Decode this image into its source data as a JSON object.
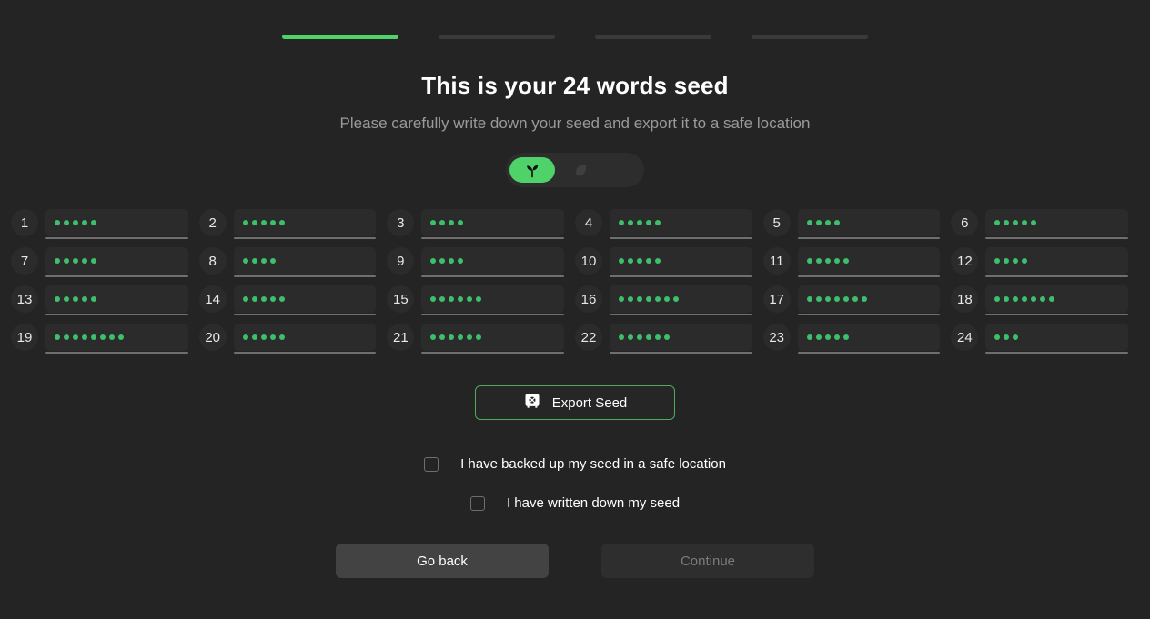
{
  "window": {
    "background": "#242424",
    "accent": "#4fd26a"
  },
  "progress": {
    "steps": [
      {
        "name": "step-1",
        "state": "active"
      },
      {
        "name": "step-2",
        "state": "inactive"
      },
      {
        "name": "step-3",
        "state": "inactive"
      },
      {
        "name": "step-4",
        "state": "inactive"
      }
    ],
    "current": 1,
    "total": 4
  },
  "header": {
    "title": "This is your 24 words seed",
    "subtitle": "Please carefully write down your seed and export it to a safe location"
  },
  "toggle": {
    "options": [
      {
        "icon": "sprout-icon",
        "selected": true
      },
      {
        "icon": "leaf-icon",
        "selected": false
      }
    ]
  },
  "seed": {
    "word_count": 24,
    "masked": true,
    "dot_color": "#3dbf6b",
    "words": [
      {
        "index": "1",
        "dots": 5
      },
      {
        "index": "2",
        "dots": 5
      },
      {
        "index": "3",
        "dots": 4
      },
      {
        "index": "4",
        "dots": 5
      },
      {
        "index": "5",
        "dots": 4
      },
      {
        "index": "6",
        "dots": 5
      },
      {
        "index": "7",
        "dots": 5
      },
      {
        "index": "8",
        "dots": 4
      },
      {
        "index": "9",
        "dots": 4
      },
      {
        "index": "10",
        "dots": 5
      },
      {
        "index": "11",
        "dots": 5
      },
      {
        "index": "12",
        "dots": 4
      },
      {
        "index": "13",
        "dots": 5
      },
      {
        "index": "14",
        "dots": 5
      },
      {
        "index": "15",
        "dots": 6
      },
      {
        "index": "16",
        "dots": 7
      },
      {
        "index": "17",
        "dots": 7
      },
      {
        "index": "18",
        "dots": 7
      },
      {
        "index": "19",
        "dots": 8
      },
      {
        "index": "20",
        "dots": 5
      },
      {
        "index": "21",
        "dots": 6
      },
      {
        "index": "22",
        "dots": 6
      },
      {
        "index": "23",
        "dots": 5
      },
      {
        "index": "24",
        "dots": 3
      }
    ]
  },
  "export": {
    "label": "Export Seed",
    "icon": "safe-vault-icon",
    "border_color": "#4fa95f"
  },
  "checkboxes": [
    {
      "label": "I have backed up my seed in a safe location",
      "checked": false
    },
    {
      "label": "I have written down my seed",
      "checked": false
    }
  ],
  "footer": {
    "back_label": "Go back",
    "continue_label": "Continue",
    "continue_enabled": false
  }
}
